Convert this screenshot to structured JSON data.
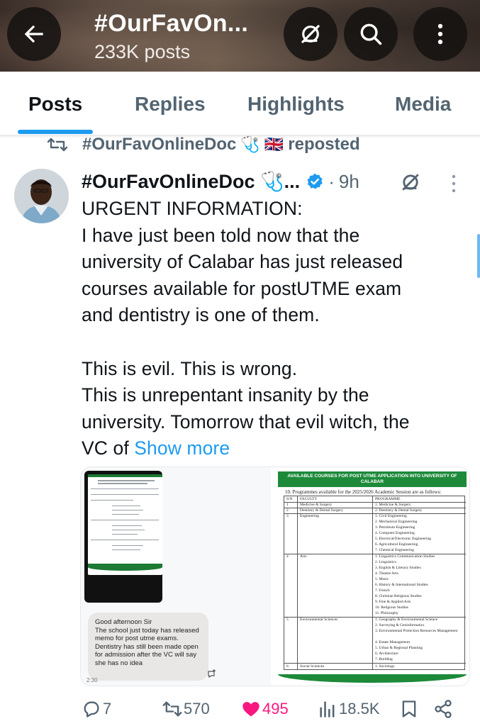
{
  "header": {
    "title": "#OurFavOn...",
    "post_count": "233K posts"
  },
  "tabs": [
    {
      "label": "Posts",
      "active": true
    },
    {
      "label": "Replies",
      "active": false
    },
    {
      "label": "Highlights",
      "active": false
    },
    {
      "label": "Media",
      "active": false
    }
  ],
  "repost": {
    "reposter": "#OurFavOnlineDoc",
    "emoji": "🩺 🇬🇧",
    "suffix": "reposted"
  },
  "tweet": {
    "author": "#OurFavOnlineDoc 🩺...",
    "separator": "·",
    "time": "9h",
    "lines": [
      "URGENT INFORMATION:",
      "I have just been told now that the",
      "university of Calabar has just released",
      "courses available for postUTME exam",
      "and dentistry is one of them.",
      "",
      "This is evil. This is wrong.",
      "This is unrepentant insanity by the",
      "university. Tomorrow that evil witch, the"
    ],
    "last_line_prefix": "VC of",
    "show_more": "Show more"
  },
  "media": {
    "chat_message": "Good afternoon Sir\nThe school just today has released memo for post utme exams. Dentistry has still been made open for admission after the VC will say she has no idea",
    "chat_time": "2:30",
    "doc_header": "AVAILABLE COURSES FOR POST UTME APPLICATION INTO UNIVERSITY OF CALABAR",
    "doc_subtitle": "10. Programmes available for the 2025/2026 Academic Session are as follows:",
    "table_headers": [
      "S/N",
      "FACULTY",
      "PROGRAMME"
    ],
    "table_rows": [
      {
        "sn": "1",
        "faculty": "Medicine & Surgery",
        "programmes": [
          "1. Medicine & Surgery"
        ]
      },
      {
        "sn": "2",
        "faculty": "Dentistry & Dental Surgery",
        "programmes": [
          "2. Dentistry & Dental Surgery"
        ]
      },
      {
        "sn": "3",
        "faculty": "Engineering",
        "programmes": [
          "1. Civil Engineering",
          "2. Mechanical Engineering",
          "3. Petroleum Engineering",
          "4. Computer Engineering",
          "5. Electrical/Electronic Engineering",
          "6. Agricultural Engineering",
          "7. Chemical Engineering"
        ]
      },
      {
        "sn": "4",
        "faculty": "Arts",
        "programmes": [
          "1. Linguistics Communication Studies",
          "2. Linguistics",
          "3. English & Literary Studies",
          "4. Theatre Arts",
          "5. Music",
          "6. History & International Studies",
          "7. French",
          "8. Christian Religious Studies",
          "9. Fine & Applied Arts",
          "10. Religious Studies",
          "11. Philosophy"
        ]
      },
      {
        "sn": "5",
        "faculty": "Environmental Sciences",
        "programmes": [
          "1. Geography & Environmental Science",
          "2. Surveying & Geoinformatics",
          "3. Environmental Protection Resources Management",
          "4. Estate Management",
          "5. Urban & Regional Planning",
          "6. Architecture",
          "7. Building"
        ]
      },
      {
        "sn": "6",
        "faculty": "Social Sciences",
        "programmes": [
          "1. Sociology"
        ]
      }
    ]
  },
  "actions": {
    "replies": "7",
    "reposts": "570",
    "likes": "495",
    "views": "18.5K"
  },
  "colors": {
    "accent": "#1d9bf0",
    "like": "#f91880",
    "muted": "#536471",
    "doc_green": "#1d8a3a"
  },
  "icons": [
    "back-arrow-icon",
    "mute-icon",
    "search-icon",
    "more-vertical-icon",
    "repost-icon",
    "verified-badge-icon",
    "reply-icon",
    "heart-icon",
    "views-icon",
    "bookmark-icon",
    "share-icon"
  ]
}
